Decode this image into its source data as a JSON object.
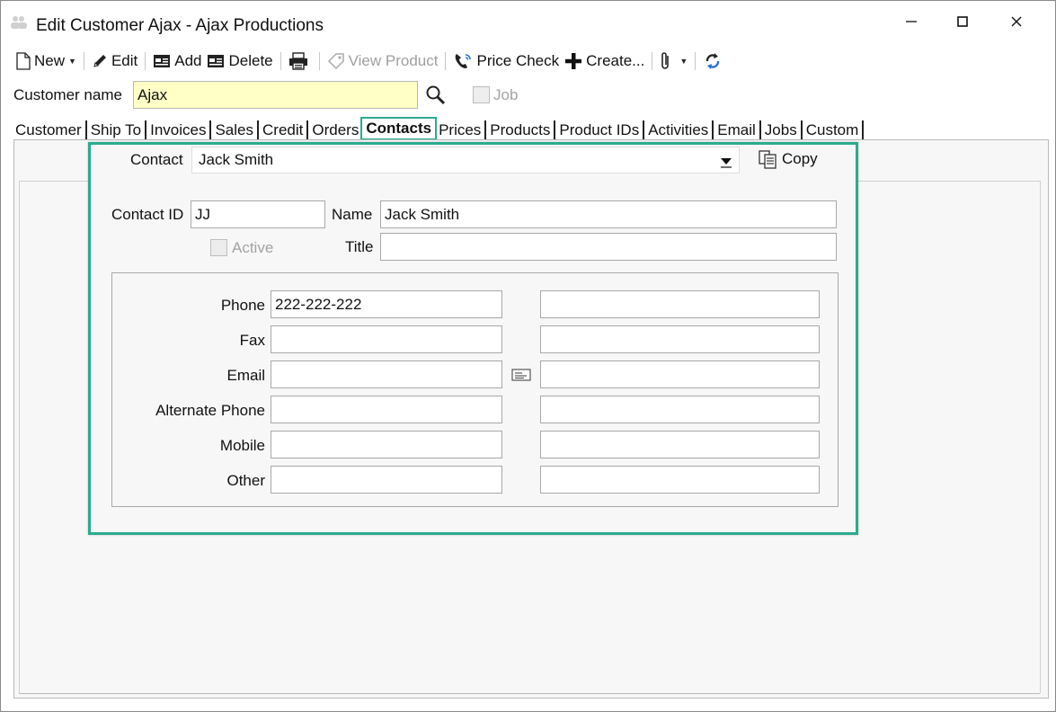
{
  "window": {
    "title": "Edit Customer Ajax - Ajax Productions",
    "minimize_glyph": "—",
    "maximize_glyph": "☐",
    "close_glyph": "✕"
  },
  "toolbar": {
    "new_label": "New",
    "edit_label": "Edit",
    "add_label": "Add",
    "delete_label": "Delete",
    "view_product_label": "View Product",
    "price_check_label": "Price Check",
    "create_label": "Create..."
  },
  "customer": {
    "label": "Customer name",
    "value": "Ajax",
    "job_label": "Job"
  },
  "tabs": [
    {
      "label": "Customer"
    },
    {
      "label": "Ship To"
    },
    {
      "label": "Invoices"
    },
    {
      "label": "Sales"
    },
    {
      "label": "Credit"
    },
    {
      "label": "Orders"
    },
    {
      "label": "Contacts"
    },
    {
      "label": "Prices"
    },
    {
      "label": "Products"
    },
    {
      "label": "Product IDs"
    },
    {
      "label": "Activities"
    },
    {
      "label": "Email"
    },
    {
      "label": "Jobs"
    },
    {
      "label": "Custom"
    }
  ],
  "contact": {
    "label": "Contact",
    "selected": "Jack Smith",
    "copy_label": "Copy",
    "id_label": "Contact ID",
    "id_value": "JJ",
    "name_label": "Name",
    "name_value": "Jack Smith",
    "active_label": "Active",
    "title_label": "Title",
    "title_value": ""
  },
  "numbers": {
    "phone_label": "Phone",
    "phone_value": "222-222-222",
    "fax_label": "Fax",
    "email_label": "Email",
    "alt_phone_label": "Alternate Phone",
    "mobile_label": "Mobile",
    "other_label": "Other"
  },
  "colors": {
    "highlight": "#2bab8e",
    "customer_field_bg": "#ffffc6"
  }
}
